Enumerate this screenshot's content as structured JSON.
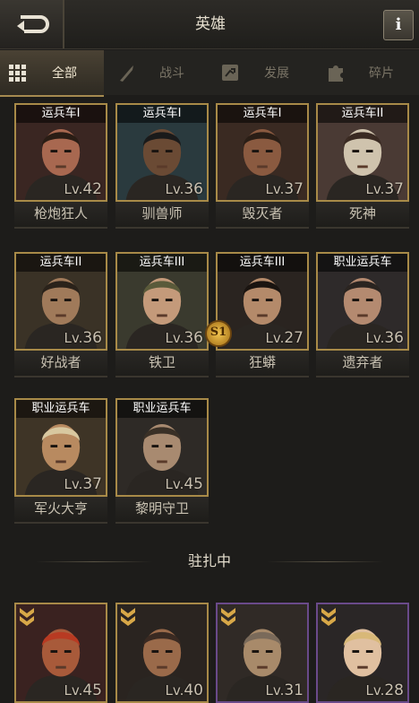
{
  "header": {
    "title": "英雄",
    "info_label": "i",
    "back_icon": "back-arrow-icon",
    "info_icon": "info-icon"
  },
  "tabs": [
    {
      "label": "全部",
      "icon": "grid-icon",
      "active": true
    },
    {
      "label": "战斗",
      "icon": "knife-icon",
      "active": false
    },
    {
      "label": "发展",
      "icon": "growth-icon",
      "active": false
    },
    {
      "label": "碎片",
      "icon": "puzzle-icon",
      "active": false
    }
  ],
  "heroes": [
    {
      "rank": "运兵车I",
      "level": "42",
      "name": "枪炮狂人",
      "skin": "#a86850",
      "hair": "#2a1d15",
      "bg": "#3a2622"
    },
    {
      "rank": "运兵车I",
      "level": "36",
      "name": "驯兽师",
      "skin": "#6a4a34",
      "hair": "#1a1a1a",
      "bg": "#2a3a3e"
    },
    {
      "rank": "运兵车I",
      "level": "37",
      "name": "毁灭者",
      "skin": "#8a5a40",
      "hair": "#2a1e16",
      "bg": "#3a2a22"
    },
    {
      "rank": "运兵车II",
      "level": "37",
      "name": "死神",
      "skin": "#cfc3ad",
      "hair": "#3a2a22",
      "bg": "#4a3a34"
    },
    {
      "rank": "运兵车II",
      "level": "36",
      "name": "好战者",
      "skin": "#a07a5a",
      "hair": "#2a221a",
      "bg": "#3a3226"
    },
    {
      "rank": "运兵车III",
      "level": "36",
      "name": "铁卫",
      "skin": "#c49a7a",
      "hair": "#5a5a3a",
      "bg": "#3a3a2e"
    },
    {
      "rank": "运兵车III",
      "level": "27",
      "name": "狂蟒",
      "skin": "#b48a6a",
      "hair": "#1a1410",
      "bg": "#2a2420"
    },
    {
      "rank": "职业运兵车",
      "level": "36",
      "name": "遗弃者",
      "skin": "#b48a70",
      "hair": "#2a2420",
      "bg": "#2e2a2a"
    },
    {
      "rank": "职业运兵车",
      "level": "37",
      "name": "军火大亨",
      "skin": "#b88a60",
      "hair": "#d8c8a0",
      "bg": "#3e3426"
    },
    {
      "rank": "职业运兵车",
      "level": "45",
      "name": "黎明守卫",
      "skin": "#a88a70",
      "hair": "#3a3026",
      "bg": "#2e2a26"
    }
  ],
  "season_badge": "S1",
  "level_prefix": "Lv.",
  "section_title": "驻扎中",
  "stationed": [
    {
      "level": "45",
      "skin": "#a85a3a",
      "hair": "#b83a22",
      "bg": "#3a2220",
      "frame": "gold",
      "icon": "rank-chevron-icon"
    },
    {
      "level": "40",
      "skin": "#9a6a4a",
      "hair": "#3a2a22",
      "bg": "#2a2420",
      "frame": "gold",
      "icon": "rank-chevron-icon"
    },
    {
      "level": "31",
      "skin": "#a88a6a",
      "hair": "#7a6a5a",
      "bg": "#302a26",
      "frame": "purple",
      "icon": "rank-chevron-icon"
    },
    {
      "level": "28",
      "skin": "#e0c0a0",
      "hair": "#d8b878",
      "bg": "#2a2626",
      "frame": "purple",
      "icon": "rank-chevron-icon"
    }
  ]
}
